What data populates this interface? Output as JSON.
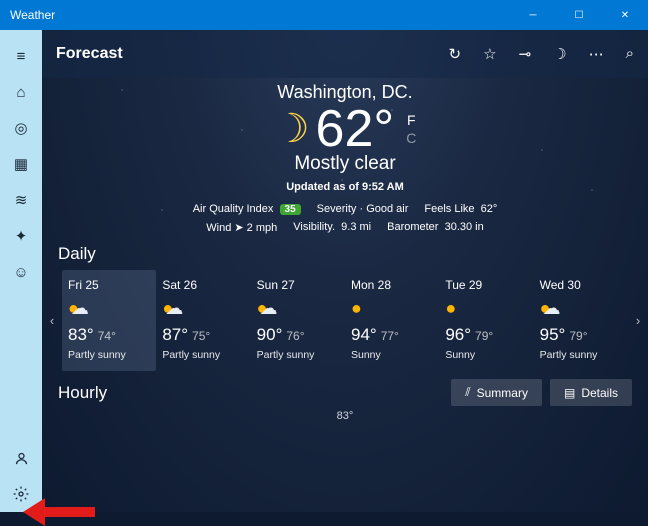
{
  "window": {
    "title": "Weather"
  },
  "topbar": {
    "page_title": "Forecast"
  },
  "hero": {
    "location": "Washington, DC.",
    "temp": "62°",
    "unit_f": "F",
    "unit_c": "C",
    "condition": "Mostly clear",
    "updated": "Updated as of 9:52 AM"
  },
  "stats": {
    "aqi_label": "Air Quality Index",
    "aqi_value": "35",
    "severity_label": "Severity",
    "severity_value": "Good air",
    "feels_label": "Feels Like",
    "feels_value": "62°",
    "wind_label": "Wind",
    "wind_value": "2 mph",
    "vis_label": "Visibility.",
    "vis_value": "9.3 mi",
    "baro_label": "Barometer",
    "baro_value": "30.30 in"
  },
  "sections": {
    "daily": "Daily",
    "hourly": "Hourly"
  },
  "daily": [
    {
      "date": "Fri 25",
      "hi": "83°",
      "lo": "74°",
      "cond": "Partly sunny",
      "icon": "partly"
    },
    {
      "date": "Sat 26",
      "hi": "87°",
      "lo": "75°",
      "cond": "Partly sunny",
      "icon": "partly"
    },
    {
      "date": "Sun 27",
      "hi": "90°",
      "lo": "76°",
      "cond": "Partly sunny",
      "icon": "partly"
    },
    {
      "date": "Mon 28",
      "hi": "94°",
      "lo": "77°",
      "cond": "Sunny",
      "icon": "sun"
    },
    {
      "date": "Tue 29",
      "hi": "96°",
      "lo": "79°",
      "cond": "Sunny",
      "icon": "sun"
    },
    {
      "date": "Wed 30",
      "hi": "95°",
      "lo": "79°",
      "cond": "Partly sunny",
      "icon": "partly"
    }
  ],
  "hourly_btns": {
    "summary": "Summary",
    "details": "Details"
  },
  "footer_temp": "83°"
}
